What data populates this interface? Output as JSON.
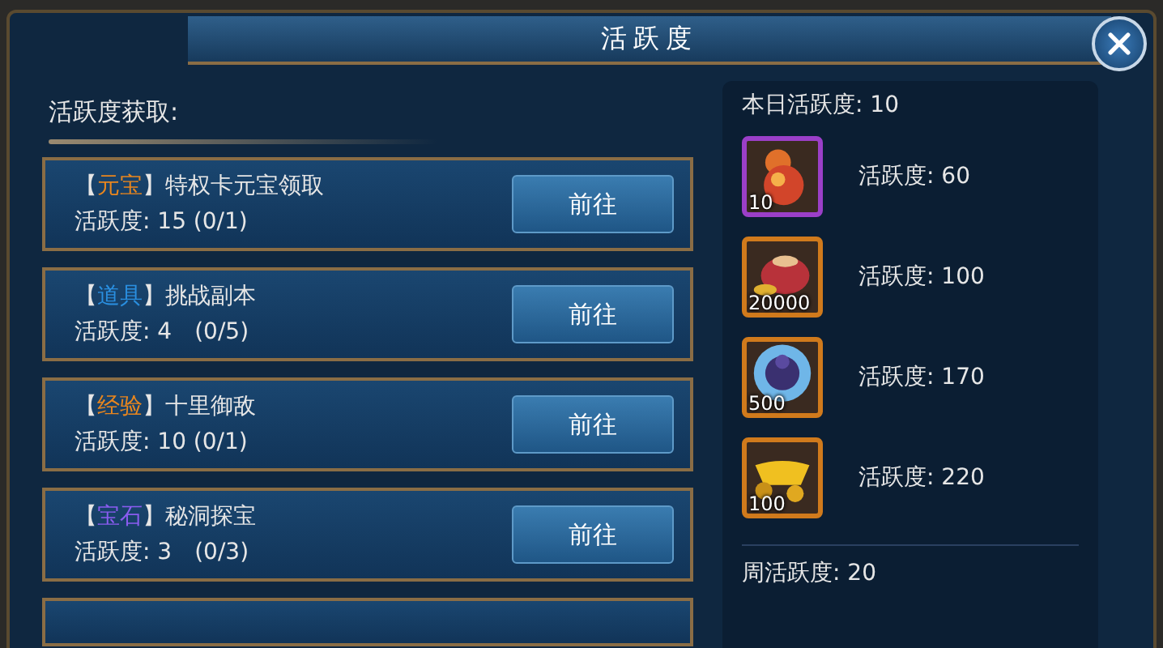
{
  "window": {
    "title": "活跃度"
  },
  "tasks_panel": {
    "heading": "活跃度获取:",
    "tasks": [
      {
        "open": "【",
        "tag": "元宝",
        "color": "#e8861e",
        "rest": "】特权卡元宝领取",
        "points": "活跃度: 15 (0/1)",
        "button": "前往"
      },
      {
        "open": "【",
        "tag": "道具",
        "color": "#2a8fe0",
        "rest": "】挑战副本",
        "points": "活跃度: 4　(0/5)",
        "button": "前往"
      },
      {
        "open": "【",
        "tag": "经验",
        "color": "#e8861e",
        "rest": "】十里御敌",
        "points": "活跃度: 10 (0/1)",
        "button": "前往"
      },
      {
        "open": "【",
        "tag": "宝石",
        "color": "#8a5cf0",
        "rest": "】秘洞探宝",
        "points": "活跃度: 3　(0/3)",
        "button": "前往"
      }
    ]
  },
  "rewards_panel": {
    "daily_heading": "本日活跃度: 10",
    "rewards": [
      {
        "kind": "gourd",
        "color": "#9b3fc8",
        "count": "10",
        "requirement": "活跃度: 60"
      },
      {
        "kind": "pouch",
        "color": "#d07a1c",
        "count": "20000",
        "requirement": "活跃度: 100"
      },
      {
        "kind": "orb",
        "color": "#d07a1c",
        "count": "500",
        "requirement": "活跃度: 170"
      },
      {
        "kind": "ingot",
        "color": "#d07a1c",
        "count": "100",
        "requirement": "活跃度: 220"
      }
    ],
    "weekly_heading": "周活跃度: 20"
  }
}
